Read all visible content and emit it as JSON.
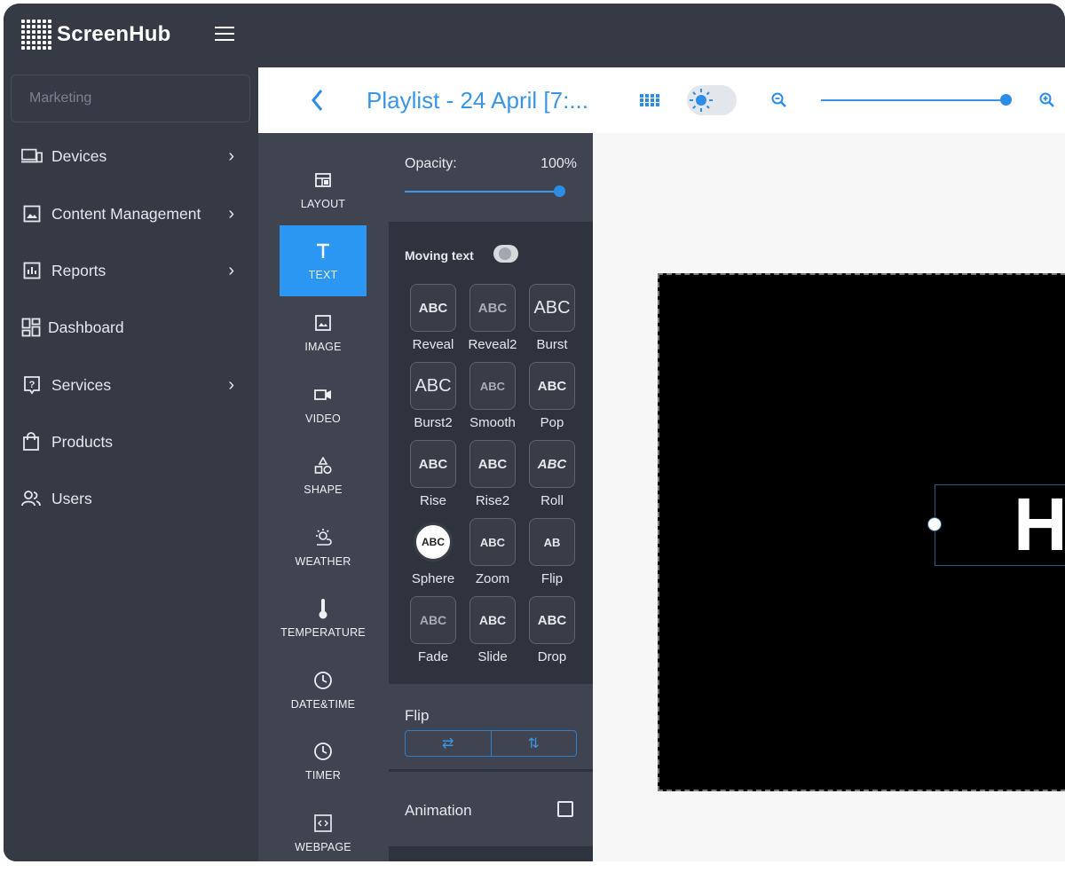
{
  "app": {
    "name": "ScreenHub"
  },
  "sidebar": {
    "search_placeholder": "Marketing",
    "items": [
      {
        "label": "Devices",
        "icon": "devices-icon",
        "has_chevron": true
      },
      {
        "label": "Content Management",
        "icon": "image-icon",
        "has_chevron": true
      },
      {
        "label": "Reports",
        "icon": "reports-icon",
        "has_chevron": true
      },
      {
        "label": "Dashboard",
        "icon": "dashboard-icon",
        "has_chevron": false
      },
      {
        "label": "Services",
        "icon": "help-icon",
        "has_chevron": true
      },
      {
        "label": "Products",
        "icon": "shopping-bag-icon",
        "has_chevron": false
      },
      {
        "label": "Users",
        "icon": "users-icon",
        "has_chevron": false
      }
    ]
  },
  "toolbar": {
    "title": "Playlist - 24 April [7:...",
    "zoom_level": 1.0
  },
  "tools": [
    {
      "label": "LAYOUT",
      "icon": "layout-icon"
    },
    {
      "label": "TEXT",
      "icon": "text-icon",
      "active": true
    },
    {
      "label": "IMAGE",
      "icon": "image-icon"
    },
    {
      "label": "VIDEO",
      "icon": "video-icon"
    },
    {
      "label": "SHAPE",
      "icon": "shape-icon"
    },
    {
      "label": "WEATHER",
      "icon": "weather-icon"
    },
    {
      "label": "TEMPERATURE",
      "icon": "thermometer-icon"
    },
    {
      "label": "DATE&TIME",
      "icon": "clock-icon"
    },
    {
      "label": "TIMER",
      "icon": "timer-icon"
    },
    {
      "label": "WEBPAGE",
      "icon": "code-icon"
    }
  ],
  "props": {
    "opacity_label": "Opacity:",
    "opacity_value": "100%",
    "moving_text_label": "Moving text",
    "effects": [
      {
        "label": "Reveal",
        "glyph": "ABC"
      },
      {
        "label": "Reveal2",
        "glyph": "ABC"
      },
      {
        "label": "Burst",
        "glyph": "ABC"
      },
      {
        "label": "Burst2",
        "glyph": "ABC"
      },
      {
        "label": "Smooth",
        "glyph": "ABC"
      },
      {
        "label": "Pop",
        "glyph": "ABC"
      },
      {
        "label": "Rise",
        "glyph": "ABC"
      },
      {
        "label": "Rise2",
        "glyph": "ABC"
      },
      {
        "label": "Roll",
        "glyph": "ABC"
      },
      {
        "label": "Sphere",
        "glyph": "ABC"
      },
      {
        "label": "Zoom",
        "glyph": "ABC"
      },
      {
        "label": "Flip",
        "glyph": "AB"
      },
      {
        "label": "Fade",
        "glyph": "ABC"
      },
      {
        "label": "Slide",
        "glyph": "ABC"
      },
      {
        "label": "Drop",
        "glyph": "ABC"
      }
    ],
    "flip_label": "Flip",
    "flip_h": "⇄",
    "flip_v": "⇅",
    "animation_label": "Animation"
  },
  "canvas": {
    "text": "H"
  }
}
